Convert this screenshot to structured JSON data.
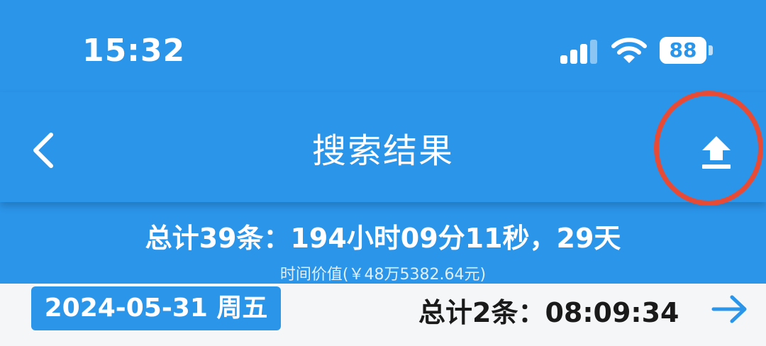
{
  "status_bar": {
    "time": "15:32",
    "battery": "88"
  },
  "nav": {
    "title": "搜索结果"
  },
  "summary": {
    "main": "总计39条：194小时09分11秒，29天",
    "sub": "时间价值(￥48万5382.64元)"
  },
  "rows": [
    {
      "date": "2024-05-31 周五",
      "total": "总计2条：08:09:34"
    }
  ],
  "colors": {
    "primary": "#2b95ea",
    "highlight": "#e84b35"
  },
  "icons": [
    "back-chevron-icon",
    "upload-icon",
    "arrow-right-icon",
    "signal-icon",
    "wifi-icon",
    "battery-icon"
  ]
}
